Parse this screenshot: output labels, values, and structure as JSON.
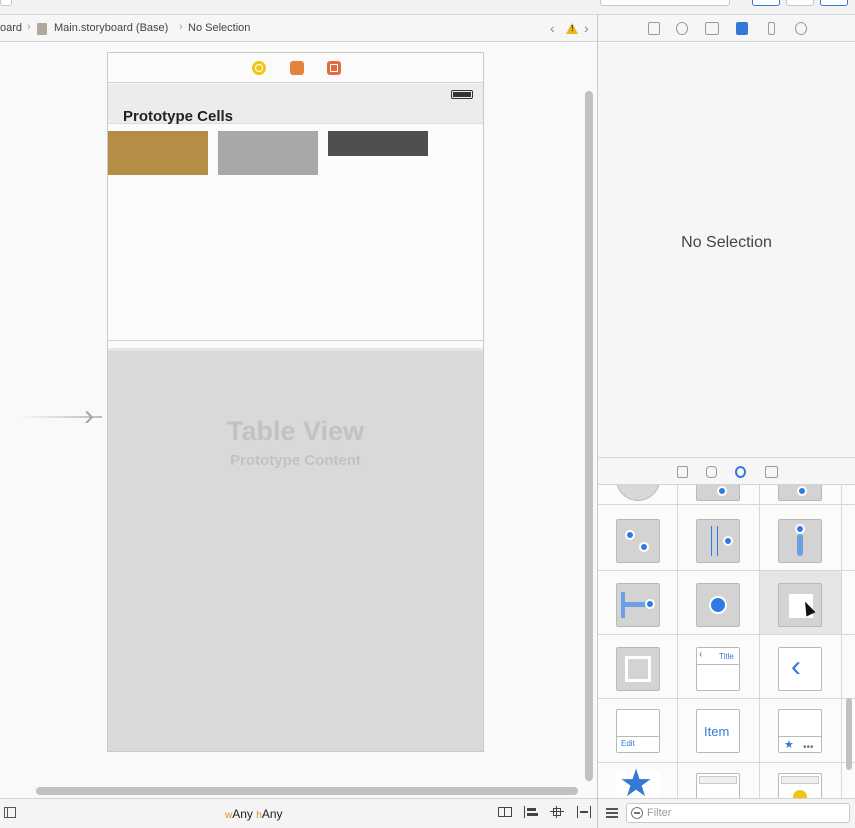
{
  "jumpbar": {
    "crumbs": [
      "oard",
      "Main.storyboard (Base)",
      "No Selection"
    ],
    "back_icon": "chevron-left-icon",
    "warning_icon": "warning-triangle-icon",
    "forward_icon": "chevron-right-icon",
    "warning_mark": "!"
  },
  "scene": {
    "dock_icons": [
      "view-controller-icon",
      "first-responder-icon",
      "exit-icon"
    ],
    "prototype_cells_title": "Prototype Cells",
    "cell_colors": [
      "#b58e45",
      "#a8a8a8",
      "#4f4f4f"
    ],
    "table_view_title": "Table View",
    "table_view_subtitle": "Prototype Content"
  },
  "bottom_bar": {
    "size_class_w_prefix": "w",
    "size_class_w_value": "Any",
    "size_class_h_prefix": "h",
    "size_class_h_value": "Any"
  },
  "inspector": {
    "tab_icons": [
      "file-inspector-icon",
      "quick-help-icon",
      "identity-inspector-icon",
      "attributes-inspector-icon",
      "size-inspector-icon",
      "connections-inspector-icon"
    ],
    "empty_state": "No Selection"
  },
  "library": {
    "tab_icons": [
      "file-template-icon",
      "code-snippet-icon",
      "object-library-icon",
      "media-library-icon"
    ],
    "item_label": "Item",
    "edit_label": "Edit",
    "title_label": "Title",
    "filter_placeholder": "Filter"
  },
  "colors": {
    "accent": "#3479d8",
    "warning": "#e7b618"
  }
}
